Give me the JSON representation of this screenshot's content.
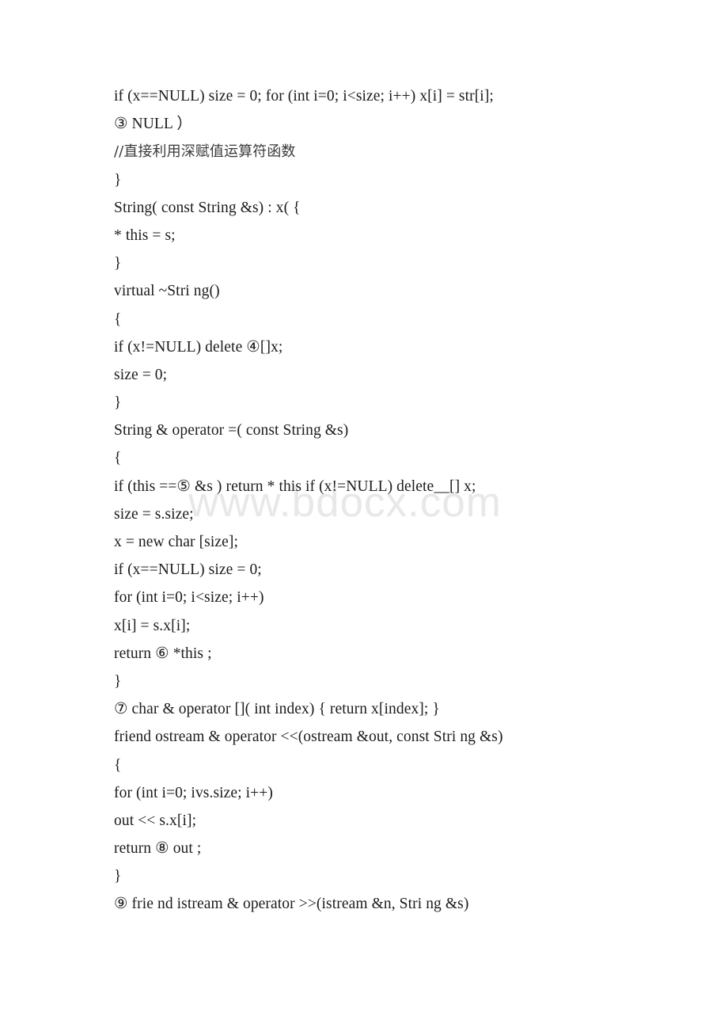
{
  "document": {
    "watermark": "www.bdocx.com",
    "lines": [
      {
        "text": "if (x==NULL) size = 0; for (int i=0; i<size; i++) x[i] = str[i];",
        "script": "latin"
      },
      {
        "text": "③ NULL ）",
        "script": "latin"
      },
      {
        "text": "//直接利用深赋值运算符函数",
        "script": "cjk"
      },
      {
        "text": "}",
        "script": "latin"
      },
      {
        "text": "String( const String &s) : x( {",
        "script": "latin"
      },
      {
        "text": "* this = s;",
        "script": "latin"
      },
      {
        "text": "}",
        "script": "latin"
      },
      {
        "text": "virtual ~Stri ng()",
        "script": "latin"
      },
      {
        "text": "{",
        "script": "latin"
      },
      {
        "text": "if (x!=NULL) delete ④[]x;",
        "script": "latin"
      },
      {
        "text": "size = 0;",
        "script": "latin"
      },
      {
        "text": "}",
        "script": "latin"
      },
      {
        "text": "String & operator =( const String &s)",
        "script": "latin"
      },
      {
        "text": "{",
        "script": "latin"
      },
      {
        "text": "if (this ==⑤ &s ) return * this if (x!=NULL) delete__[] x;",
        "script": "latin"
      },
      {
        "text": "size = s.size;",
        "script": "latin"
      },
      {
        "text": "x = new char [size];",
        "script": "latin"
      },
      {
        "text": "if (x==NULL) size = 0;",
        "script": "latin"
      },
      {
        "text": "for (int i=0; i<size; i++)",
        "script": "latin"
      },
      {
        "text": "x[i] = s.x[i];",
        "script": "latin"
      },
      {
        "text": "return ⑥ *this ;",
        "script": "latin"
      },
      {
        "text": "}",
        "script": "latin"
      },
      {
        "text": "⑦ char & operator []( int index) { return x[index]; }",
        "script": "latin"
      },
      {
        "text": "friend ostream & operator <<(ostream &out, const Stri ng &s)",
        "script": "latin"
      },
      {
        "text": "{",
        "script": "latin"
      },
      {
        "text": "for (int i=0; ivs.size; i++)",
        "script": "latin"
      },
      {
        "text": "out << s.x[i];",
        "script": "latin"
      },
      {
        "text": "return ⑧ out ;",
        "script": "latin"
      },
      {
        "text": "}",
        "script": "latin"
      },
      {
        "text": "⑨ frie nd istream & operator >>(istream &n, Stri ng &s)",
        "script": "latin"
      }
    ]
  }
}
